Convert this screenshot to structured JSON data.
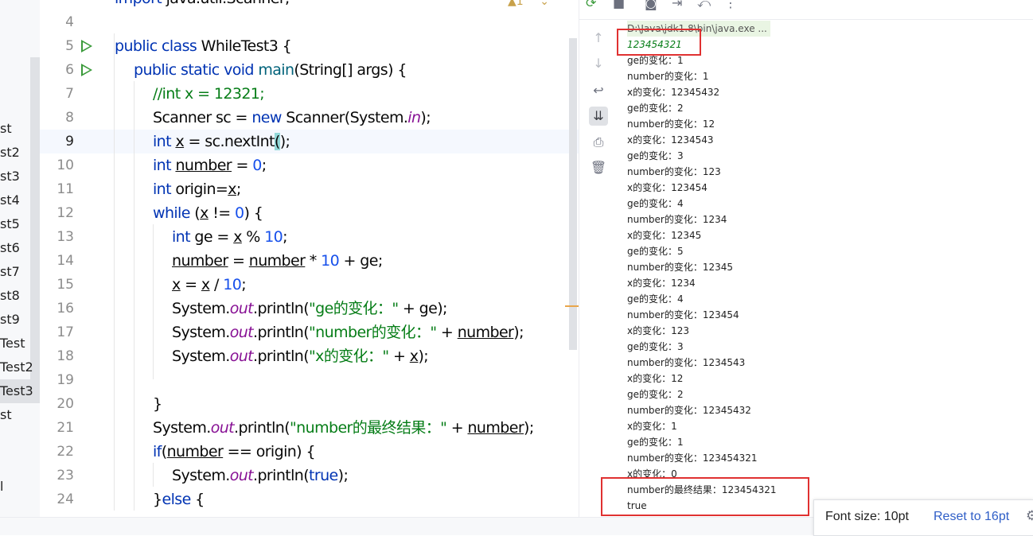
{
  "project_tree": {
    "items": [
      "st",
      "st2",
      "st3",
      "st4",
      "st5",
      "st6",
      "st7",
      "st8",
      "st9",
      "Test",
      "Test2",
      "Test3",
      "st",
      "l"
    ],
    "selected_index": 11
  },
  "editor": {
    "current_line": "9",
    "lines": [
      {
        "n": "4",
        "t": "import java.util.Scanner;"
      },
      {
        "n": "5",
        "t": "public class WhileTest3 {"
      },
      {
        "n": "6",
        "t": "public static void main(String[] args) {"
      },
      {
        "n": "7",
        "t": "//int x = 12321;"
      },
      {
        "n": "8",
        "t": "Scanner sc = new Scanner(System.in);"
      },
      {
        "n": "9",
        "t": "int x = sc.nextInt();"
      },
      {
        "n": "10",
        "t": "int number = 0;"
      },
      {
        "n": "11",
        "t": "int origin=x;"
      },
      {
        "n": "12",
        "t": "while (x != 0) {"
      },
      {
        "n": "13",
        "t": "int ge = x % 10;"
      },
      {
        "n": "14",
        "t": "number = number * 10 + ge;"
      },
      {
        "n": "15",
        "t": "x = x / 10;"
      },
      {
        "n": "16",
        "t": "System.out.println(\"ge的变化：\" + ge);"
      },
      {
        "n": "17",
        "t": "System.out.println(\"number的变化：\" + number);"
      },
      {
        "n": "18",
        "t": "System.out.println(\"x的变化：\" + x);"
      },
      {
        "n": "19",
        "t": ""
      },
      {
        "n": "20",
        "t": "}"
      },
      {
        "n": "21",
        "t": "System.out.println(\"number的最终结果：\" + number);"
      },
      {
        "n": "22",
        "t": "if(number == origin) {"
      },
      {
        "n": "23",
        "t": "System.out.println(true);"
      },
      {
        "n": "24",
        "t": "}else {"
      }
    ],
    "run_gutter_lines": [
      "5",
      "6"
    ]
  },
  "console": {
    "toolbar_icons": [
      "rerun-icon",
      "stop-icon",
      "camera-icon",
      "exit-icon",
      "restore-icon",
      "more-icon"
    ],
    "side_icons": [
      "up-arrow-icon",
      "down-arrow-icon",
      "soft-wrap-icon",
      "scroll-to-end-icon",
      "print-icon",
      "trash-icon"
    ],
    "command": "D:\\Java\\jdk1.8\\bin\\java.exe ...",
    "input": "123454321",
    "output": [
      "ge的变化：1",
      "number的变化：1",
      "x的变化：12345432",
      "ge的变化：2",
      "number的变化：12",
      "x的变化：1234543",
      "ge的变化：3",
      "number的变化：123",
      "x的变化：123454",
      "ge的变化：4",
      "number的变化：1234",
      "x的变化：12345",
      "ge的变化：5",
      "number的变化：12345",
      "x的变化：1234",
      "ge的变化：4",
      "number的变化：123454",
      "x的变化：123",
      "ge的变化：3",
      "number的变化：1234543",
      "x的变化：12",
      "ge的变化：2",
      "number的变化：12345432",
      "x的变化：1",
      "ge的变化：1",
      "number的变化：123454321",
      "x的变化：0",
      "number的最终结果：123454321",
      "true"
    ]
  },
  "font_popup": {
    "label": "Font size: 10pt",
    "reset_link": "Reset to 16pt"
  },
  "colors": {
    "keyword": "#0033b3",
    "number": "#1750eb",
    "string": "#067d17",
    "field": "#871094",
    "annotation_box": "#e03131"
  }
}
